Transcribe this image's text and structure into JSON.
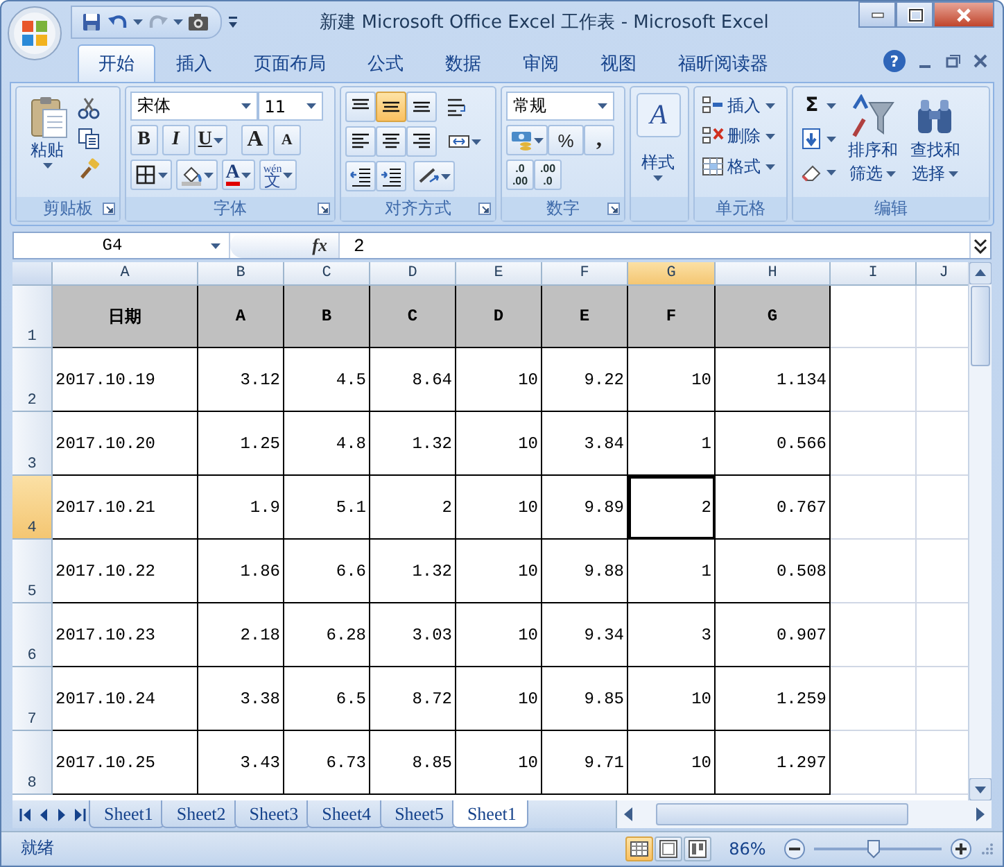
{
  "window": {
    "title": "新建 Microsoft Office Excel 工作表 - Microsoft Excel"
  },
  "ribbon_tabs": [
    {
      "label": "开始",
      "selected": true
    },
    {
      "label": "插入",
      "selected": false
    },
    {
      "label": "页面布局",
      "selected": false
    },
    {
      "label": "公式",
      "selected": false
    },
    {
      "label": "数据",
      "selected": false
    },
    {
      "label": "审阅",
      "selected": false
    },
    {
      "label": "视图",
      "selected": false
    },
    {
      "label": "福昕阅读器",
      "selected": false
    }
  ],
  "help": "?",
  "ribbon": {
    "clipboard": {
      "label": "剪贴板",
      "paste": "粘贴"
    },
    "font": {
      "label": "字体",
      "font_name": "宋体",
      "font_size": "11",
      "bold": "B",
      "italic": "I",
      "underline": "U",
      "grow": "A",
      "shrink": "A",
      "phonetic": "文",
      "phonetic_ruby": "wén",
      "font_color": "A"
    },
    "alignment": {
      "label": "对齐方式",
      "vertical": [
        {
          "selected": false
        },
        {
          "selected": true
        },
        {
          "selected": false
        }
      ]
    },
    "number": {
      "label": "数字",
      "format": "常规",
      "percent": "%",
      "comma": ",",
      "increase_decimal": [
        ".0",
        ".00"
      ],
      "decrease_decimal": [
        ".00",
        ".0"
      ]
    },
    "styles": {
      "button": "样式",
      "icon_letter": "A"
    },
    "cells": {
      "label": "单元格",
      "items": [
        "插入",
        "删除",
        "格式"
      ]
    },
    "editing": {
      "label": "编辑",
      "sum": "Σ",
      "sort": [
        "排序和",
        "筛选"
      ],
      "find": [
        "查找和",
        "选择"
      ]
    }
  },
  "formula_bar": {
    "name_box": "G4",
    "fx": "fx",
    "value": "2"
  },
  "sheet": {
    "columns": [
      {
        "label": "A",
        "selected": false
      },
      {
        "label": "B",
        "selected": false
      },
      {
        "label": "C",
        "selected": false
      },
      {
        "label": "D",
        "selected": false
      },
      {
        "label": "E",
        "selected": false
      },
      {
        "label": "F",
        "selected": false
      },
      {
        "label": "G",
        "selected": true
      },
      {
        "label": "H",
        "selected": false
      },
      {
        "label": "I",
        "selected": false
      },
      {
        "label": "J",
        "selected": false
      }
    ],
    "rows": [
      {
        "number": "1",
        "kind": "header",
        "selected": false,
        "cells": [
          "日期",
          "A",
          "B",
          "C",
          "D",
          "E",
          "F",
          "G"
        ]
      },
      {
        "number": "2",
        "kind": "data",
        "selected": false,
        "cells": [
          "2017.10.19",
          "3.12",
          "4.5",
          "8.64",
          "10",
          "9.22",
          "10",
          "1.134"
        ]
      },
      {
        "number": "3",
        "kind": "data",
        "selected": false,
        "cells": [
          "2017.10.20",
          "1.25",
          "4.8",
          "1.32",
          "10",
          "3.84",
          "1",
          "0.566"
        ]
      },
      {
        "number": "4",
        "kind": "data",
        "selected": true,
        "cells": [
          "2017.10.21",
          "1.9",
          "5.1",
          "2",
          "10",
          "9.89",
          "2",
          "0.767"
        ]
      },
      {
        "number": "5",
        "kind": "data",
        "selected": false,
        "cells": [
          "2017.10.22",
          "1.86",
          "6.6",
          "1.32",
          "10",
          "9.88",
          "1",
          "0.508"
        ]
      },
      {
        "number": "6",
        "kind": "data",
        "selected": false,
        "cells": [
          "2017.10.23",
          "2.18",
          "6.28",
          "3.03",
          "10",
          "9.34",
          "3",
          "0.907"
        ]
      },
      {
        "number": "7",
        "kind": "data",
        "selected": false,
        "cells": [
          "2017.10.24",
          "3.38",
          "6.5",
          "8.72",
          "10",
          "9.85",
          "10",
          "1.259"
        ]
      },
      {
        "number": "8",
        "kind": "data",
        "selected": false,
        "cells": [
          "2017.10.25",
          "3.43",
          "6.73",
          "8.85",
          "10",
          "9.71",
          "10",
          "1.297"
        ]
      }
    ]
  },
  "sheet_tabs": [
    {
      "label": "Sheet1",
      "selected": false
    },
    {
      "label": "Sheet2",
      "selected": false
    },
    {
      "label": "Sheet3",
      "selected": false
    },
    {
      "label": "Sheet4",
      "selected": false
    },
    {
      "label": "Sheet5",
      "selected": false
    },
    {
      "label": "Sheet1",
      "selected": true
    }
  ],
  "status_bar": {
    "status": "就绪",
    "views": [
      {
        "selected": true
      },
      {
        "selected": false
      },
      {
        "selected": false
      }
    ],
    "zoom": "86%",
    "zoom_slider": {
      "level": 0.47
    }
  }
}
